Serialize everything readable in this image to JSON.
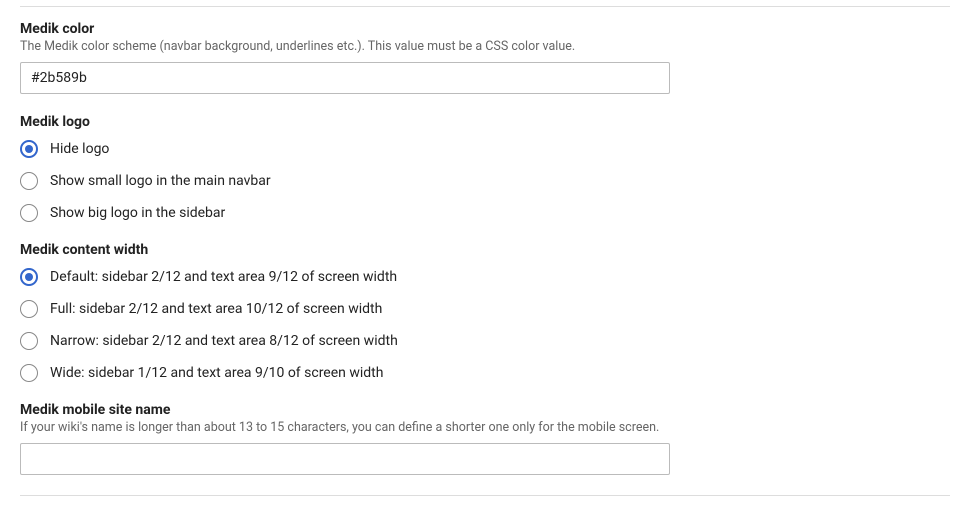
{
  "color": {
    "label": "Medik color",
    "help": "The Medik color scheme (navbar background, underlines etc.). This value must be a CSS color value.",
    "value": "#2b589b"
  },
  "logo": {
    "label": "Medik logo",
    "options": [
      {
        "label": "Hide logo",
        "checked": true
      },
      {
        "label": "Show small logo in the main navbar",
        "checked": false
      },
      {
        "label": "Show big logo in the sidebar",
        "checked": false
      }
    ]
  },
  "width": {
    "label": "Medik content width",
    "options": [
      {
        "label": "Default: sidebar 2/12 and text area 9/12 of screen width",
        "checked": true
      },
      {
        "label": "Full: sidebar 2/12 and text area 10/12 of screen width",
        "checked": false
      },
      {
        "label": "Narrow: sidebar 2/12 and text area 8/12 of screen width",
        "checked": false
      },
      {
        "label": "Wide: sidebar 1/12 and text area 9/10 of screen width",
        "checked": false
      }
    ]
  },
  "mobile": {
    "label": "Medik mobile site name",
    "help": "If your wiki's name is longer than about 13 to 15 characters, you can define a shorter one only for the mobile screen.",
    "value": ""
  }
}
